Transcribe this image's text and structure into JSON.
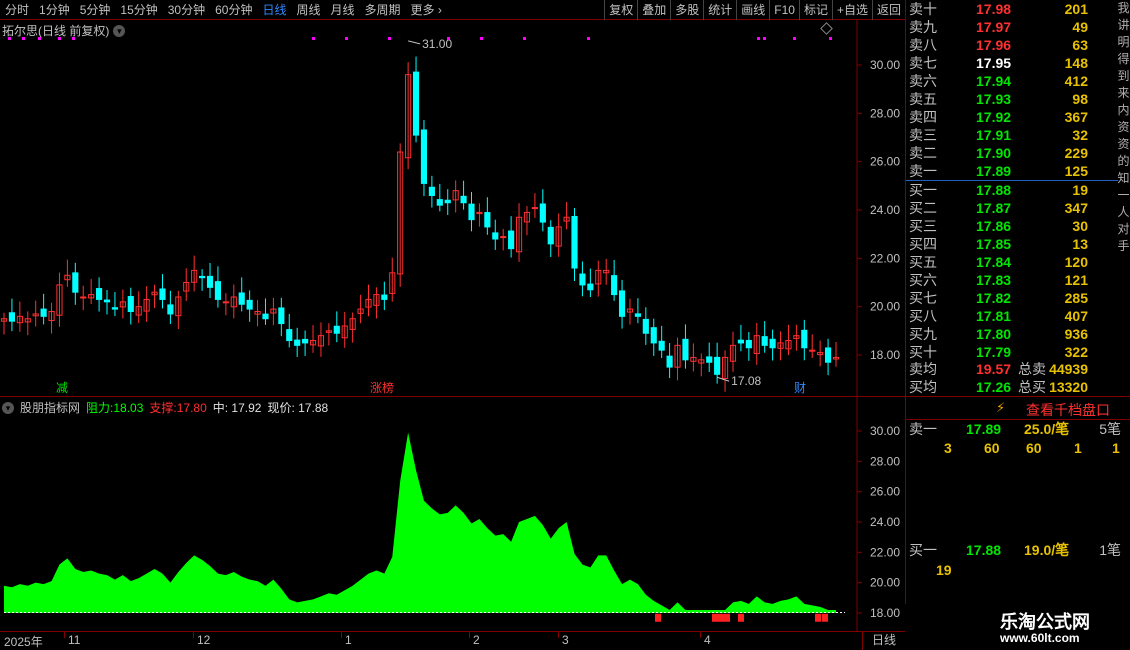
{
  "toolbar": {
    "periods": [
      "分时",
      "1分钟",
      "5分钟",
      "15分钟",
      "30分钟",
      "60分钟",
      "日线",
      "周线",
      "月线",
      "多周期",
      "更多"
    ],
    "active_period": "日线",
    "actions": [
      "复权",
      "叠加",
      "多股",
      "统计",
      "画线",
      "F10",
      "标记",
      "+自选",
      "返回"
    ]
  },
  "main_chart": {
    "title": "拓尔思(日线 前复权)",
    "max_label": "31.00",
    "min_label": "17.08",
    "markers": [
      "减",
      "涨榜",
      "财"
    ],
    "y_ticks": [
      "30.00",
      "28.00",
      "26.00",
      "24.00",
      "22.00",
      "20.00",
      "18.00"
    ]
  },
  "sub_chart": {
    "name": "股朋指标网",
    "resistance_label": "阻力:",
    "resistance_value": "18.03",
    "support_label": "支撑:",
    "support_value": "17.80",
    "middle": "中: 17.92",
    "current": "现价: 17.88",
    "y_ticks": [
      "30.00",
      "28.00",
      "26.00",
      "24.00",
      "22.00",
      "20.00",
      "18.00"
    ]
  },
  "time_axis": {
    "labels": [
      "2025年",
      "11",
      "12",
      "1",
      "2",
      "3",
      "4"
    ],
    "period": "日线"
  },
  "order_book": {
    "asks": [
      {
        "label": "卖十",
        "price": "17.98",
        "vol": "201",
        "dir": "up"
      },
      {
        "label": "卖九",
        "price": "17.97",
        "vol": "49",
        "dir": "up"
      },
      {
        "label": "卖八",
        "price": "17.96",
        "vol": "63",
        "dir": "up"
      },
      {
        "label": "卖七",
        "price": "17.95",
        "vol": "148",
        "dir": "flat"
      },
      {
        "label": "卖六",
        "price": "17.94",
        "vol": "412",
        "dir": "down"
      },
      {
        "label": "卖五",
        "price": "17.93",
        "vol": "98",
        "dir": "down"
      },
      {
        "label": "卖四",
        "price": "17.92",
        "vol": "367",
        "dir": "down"
      },
      {
        "label": "卖三",
        "price": "17.91",
        "vol": "32",
        "dir": "down"
      },
      {
        "label": "卖二",
        "price": "17.90",
        "vol": "229",
        "dir": "down"
      },
      {
        "label": "卖一",
        "price": "17.89",
        "vol": "125",
        "dir": "down"
      }
    ],
    "bids": [
      {
        "label": "买一",
        "price": "17.88",
        "vol": "19",
        "dir": "down"
      },
      {
        "label": "买二",
        "price": "17.87",
        "vol": "347",
        "dir": "down"
      },
      {
        "label": "买三",
        "price": "17.86",
        "vol": "30",
        "dir": "down"
      },
      {
        "label": "买四",
        "price": "17.85",
        "vol": "13",
        "dir": "down"
      },
      {
        "label": "买五",
        "price": "17.84",
        "vol": "120",
        "dir": "down"
      },
      {
        "label": "买六",
        "price": "17.83",
        "vol": "121",
        "dir": "down"
      },
      {
        "label": "买七",
        "price": "17.82",
        "vol": "285",
        "dir": "down"
      },
      {
        "label": "买八",
        "price": "17.81",
        "vol": "407",
        "dir": "down"
      },
      {
        "label": "买九",
        "price": "17.80",
        "vol": "936",
        "dir": "down"
      },
      {
        "label": "买十",
        "price": "17.79",
        "vol": "322",
        "dir": "down"
      }
    ],
    "avg_sell_label": "卖均",
    "avg_sell": "19.57",
    "total_sell_label": "总卖",
    "total_sell": "44939",
    "avg_buy_label": "买均",
    "avg_buy": "17.26",
    "total_buy_label": "总买",
    "total_buy": "13320",
    "edge_text": "我讲明得到来内资资的知一人对手"
  },
  "tick_panel": {
    "button": "查看千档盘口",
    "sell1_label": "卖一",
    "sell1_price": "17.89",
    "sell1_per": "25.0/笔",
    "sell1_count": "5笔",
    "sell1_lots": [
      "3",
      "60",
      "60",
      "1",
      "1"
    ],
    "buy1_label": "买一",
    "buy1_price": "17.88",
    "buy1_per": "19.0/笔",
    "buy1_count": "1笔",
    "buy1_lots": [
      "19"
    ]
  },
  "brand": {
    "name": "乐淘公式网",
    "url": "www.60lt.com"
  },
  "colors": {
    "up": "#ff3030",
    "down": "#00e600",
    "fill": "#00ff00",
    "accent": "#2f87ff",
    "volume": "#e8c200"
  }
}
